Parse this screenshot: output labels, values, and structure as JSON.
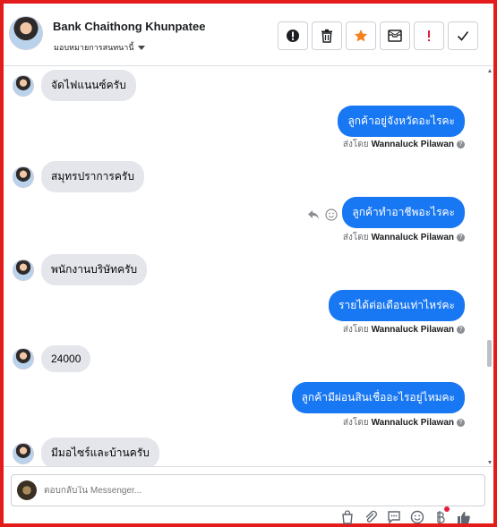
{
  "header": {
    "name": "Bank Chaithong Khunpatee",
    "assign_label": "มอบหมายการสนทนานี้",
    "actions": [
      "alert-circle-icon",
      "trash-icon",
      "star-icon",
      "mail-icon",
      "exclamation-icon",
      "check-icon"
    ]
  },
  "messages": [
    {
      "dir": "in",
      "text": "จัดไฟแนนซ์ครับ"
    },
    {
      "dir": "out",
      "text": "ลูกค้าอยู่จังหวัดอะไรคะ",
      "sent_prefix": "ส่งโดย",
      "sender": "Wannaluck Pilawan"
    },
    {
      "dir": "in",
      "text": "สมุทรปราการครับ"
    },
    {
      "dir": "out",
      "text": "ลูกค้าทำอาชีพอะไรคะ",
      "sent_prefix": "ส่งโดย",
      "sender": "Wannaluck Pilawan"
    },
    {
      "dir": "in",
      "text": "พนักงานบริษัทครับ"
    },
    {
      "dir": "out",
      "text": "รายได้ต่อเดือนเท่าไหร่คะ",
      "sent_prefix": "ส่งโดย",
      "sender": "Wannaluck Pilawan"
    },
    {
      "dir": "in",
      "text": "24000"
    },
    {
      "dir": "out",
      "text": "ลูกค้ามีผ่อนสินเชื่ออะไรอยู่ไหมคะ",
      "sent_prefix": "ส่งโดย",
      "sender": "Wannaluck Pilawan"
    },
    {
      "dir": "in",
      "text": "มีมอไซร์และบ้านครับ"
    }
  ],
  "composer": {
    "placeholder": "ตอบกลับใน Messenger..."
  },
  "colors": {
    "frame": "#e31b1b",
    "bubble_out": "#1877f2",
    "bubble_in": "#e4e6eb",
    "star": "#f5821f",
    "alert": "#e41e3f"
  }
}
